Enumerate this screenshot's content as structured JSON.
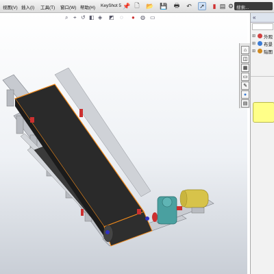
{
  "menubar": {
    "items": [
      {
        "label": "视图(V)"
      },
      {
        "label": "插入(I)"
      },
      {
        "label": "工具(T)"
      },
      {
        "label": "窗口(W)"
      },
      {
        "label": "帮助(H)"
      },
      {
        "label": "KeyShot 5"
      }
    ],
    "search_label": "搜索..."
  },
  "toolbar_icons": [
    "pin-icon",
    "new-document-icon",
    "open-icon",
    "save-icon",
    "print-icon",
    "undo-icon",
    "select-pointer-icon",
    "rebuild-icon",
    "file-properties-icon",
    "options-icon"
  ],
  "viewport_toolbar_icons": [
    "zoom-to-fit-icon",
    "zoom-area-icon",
    "previous-view-icon",
    "section-view-icon",
    "view-orientation-icon",
    "display-style-icon",
    "hide-show-icon",
    "edit-appearance-icon",
    "apply-scene-icon",
    "view-settings-icon"
  ],
  "side_tabs": [
    "appearance-tab-icon",
    "scene-tab-icon",
    "decal-tab-icon",
    "folder-tab-icon",
    "walkthrough-tab-icon",
    "display-manager-tab-icon",
    "custom-properties-tab-icon"
  ],
  "task_pane": {
    "collapse_glyph": "«",
    "tree": [
      {
        "label": "外观",
        "icon_color": "#d04040"
      },
      {
        "label": "布景",
        "icon_color": "#3a7bd5"
      },
      {
        "label": "贴图",
        "icon_color": "#d08a20"
      }
    ],
    "preview_color": "#ffff88"
  },
  "model": {
    "belt_color": "#2a2a2a",
    "frame_color": "#c9ccd2",
    "highlight_color": "#f08a1c",
    "motor_color": "#d7c34a",
    "gearbox_color": "#4aa0a0",
    "coupling_color": "#cc3030",
    "drum_accent_color": "#3030c0"
  }
}
